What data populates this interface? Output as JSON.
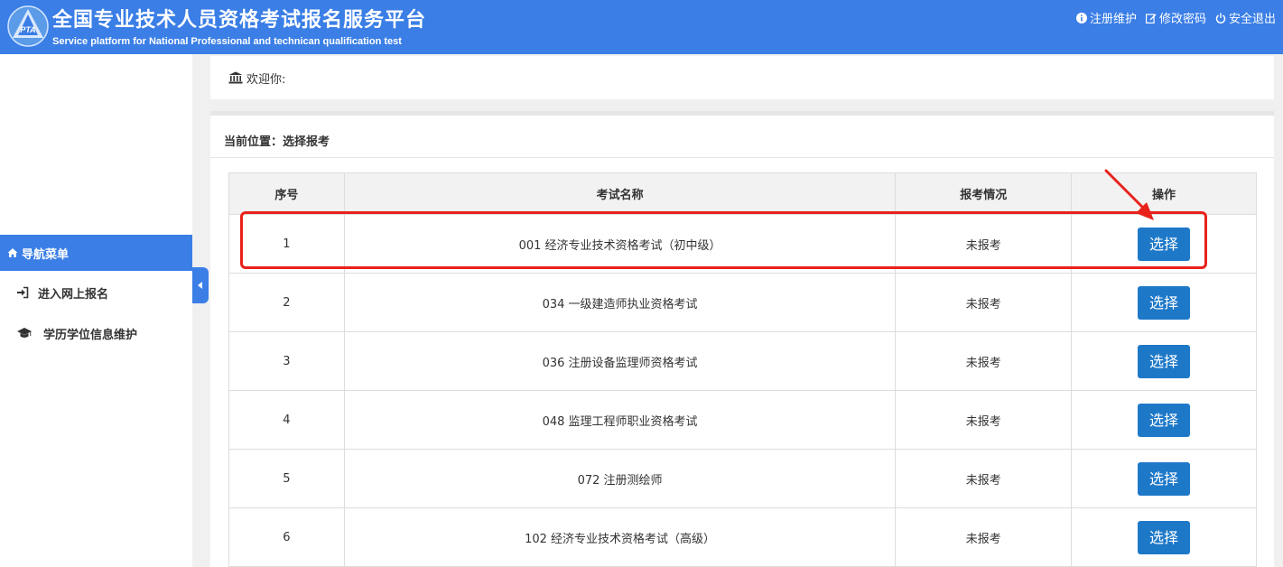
{
  "header": {
    "title_cn": "全国专业技术人员资格考试报名服务平台",
    "title_en": "Service platform for National Professional and technican qualification test",
    "logo_text": "PTA",
    "links": {
      "register": "注册维护",
      "password": "修改密码",
      "logout": "安全退出"
    }
  },
  "sidebar": {
    "nav_title": "导航菜单",
    "items": [
      {
        "label": "进入网上报名",
        "icon": "sign-in-icon"
      },
      {
        "label": "学历学位信息维护",
        "icon": "graduation-cap-icon"
      }
    ]
  },
  "welcome": {
    "text": "欢迎你:"
  },
  "breadcrumb": {
    "text": "当前位置：选择报考"
  },
  "table": {
    "headers": [
      "序号",
      "考试名称",
      "报考情况",
      "操作"
    ],
    "rows": [
      {
        "no": "1",
        "name": "001 经济专业技术资格考试（初中级）",
        "status": "未报考",
        "action": "选择"
      },
      {
        "no": "2",
        "name": "034 一级建造师执业资格考试",
        "status": "未报考",
        "action": "选择"
      },
      {
        "no": "3",
        "name": "036 注册设备监理师资格考试",
        "status": "未报考",
        "action": "选择"
      },
      {
        "no": "4",
        "name": "048 监理工程师职业资格考试",
        "status": "未报考",
        "action": "选择"
      },
      {
        "no": "5",
        "name": "072 注册测绘师",
        "status": "未报考",
        "action": "选择"
      },
      {
        "no": "6",
        "name": "102 经济专业技术资格考试（高级）",
        "status": "未报考",
        "action": "选择"
      }
    ]
  },
  "colors": {
    "header_bg": "#3a7ee6",
    "button_bg": "#1e78c8",
    "annotation": "#e8221b"
  }
}
